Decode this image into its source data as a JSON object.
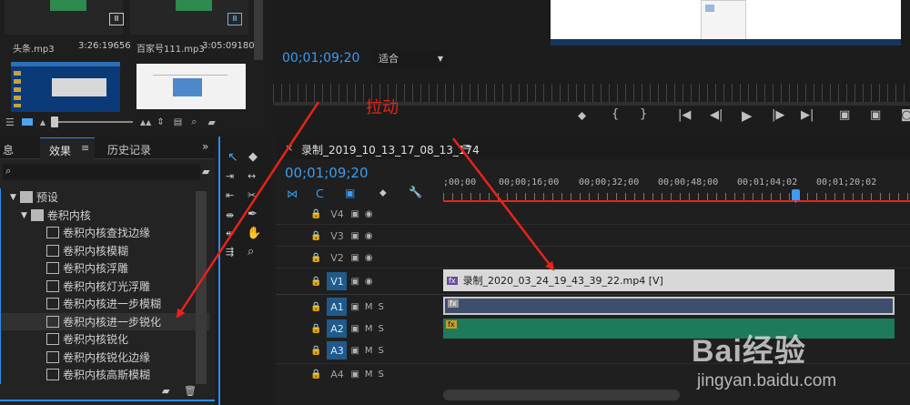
{
  "project": {
    "media": [
      {
        "name": "头条.mp3",
        "duration": "3:26:19656"
      },
      {
        "name": "百家号111.mp3",
        "duration": "3:05:09180"
      }
    ]
  },
  "program": {
    "timecode": "00;01;09;20",
    "fit_label": "适合"
  },
  "effects_panel": {
    "tabs": [
      "息",
      "效果",
      "历史记录"
    ],
    "tree": [
      {
        "label": "预设",
        "level": 0
      },
      {
        "label": "卷积内核",
        "level": 1
      },
      {
        "label": "卷积内核查找边缘",
        "level": 2
      },
      {
        "label": "卷积内核模糊",
        "level": 2
      },
      {
        "label": "卷积内核浮雕",
        "level": 2
      },
      {
        "label": "卷积内核灯光浮雕",
        "level": 2
      },
      {
        "label": "卷积内核进一步模糊",
        "level": 2
      },
      {
        "label": "卷积内核进一步锐化",
        "level": 2,
        "selected": true
      },
      {
        "label": "卷积内核锐化",
        "level": 2
      },
      {
        "label": "卷积内核锐化边缘",
        "level": 2
      },
      {
        "label": "卷积内核高斯模糊",
        "level": 2
      }
    ]
  },
  "timeline": {
    "sequence_name": "录制_2019_10_13_17_08_13_174",
    "timecode": "00;01;09;20",
    "ruler": [
      ";00;00",
      "00;00;16;00",
      "00;00;32;00",
      "00;00;48;00",
      "00;01;04;02",
      "00;01;20;02"
    ],
    "tracks": [
      {
        "name": "V4"
      },
      {
        "name": "V3"
      },
      {
        "name": "V2"
      },
      {
        "name": "V1",
        "active": true
      },
      {
        "name": "A1",
        "active": true
      },
      {
        "name": "A2",
        "active": true
      },
      {
        "name": "A3",
        "active": true
      },
      {
        "name": "A4"
      }
    ],
    "track_m": "M",
    "track_s": "S",
    "video_clip": "录制_2020_03_24_19_43_39_22.mp4 [V]",
    "fx_badge": "fx"
  },
  "annotation": {
    "label": "拉动",
    "color": "#e8231a"
  },
  "watermark": {
    "brand": "Bai经验",
    "url": "jingyan.baidu.com"
  }
}
